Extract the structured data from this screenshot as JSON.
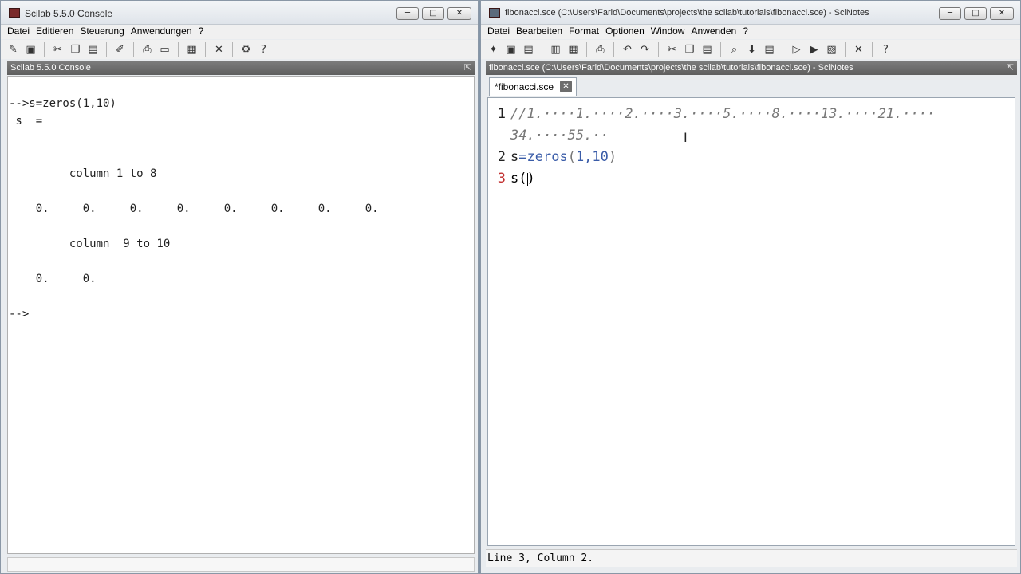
{
  "console": {
    "title": "Scilab 5.5.0 Console",
    "menu": [
      "Datei",
      "Editieren",
      "Steuerung",
      "Anwendungen",
      "?"
    ],
    "dock_title": "Scilab 5.5.0 Console",
    "lines": [
      "-->s=zeros(1,10)",
      " s  =",
      "",
      "",
      "         column 1 to 8",
      "",
      "    0.     0.     0.     0.     0.     0.     0.     0.",
      "",
      "         column  9 to 10",
      "",
      "    0.     0.",
      "",
      "-->"
    ]
  },
  "scinotes": {
    "title": "fibonacci.sce (C:\\Users\\Farid\\Documents\\projects\\the scilab\\tutorials\\fibonacci.sce) - SciNotes",
    "menu": [
      "Datei",
      "Bearbeiten",
      "Format",
      "Optionen",
      "Window",
      "Anwenden",
      "?"
    ],
    "dock_title": "fibonacci.sce (C:\\Users\\Farid\\Documents\\projects\\the scilab\\tutorials\\fibonacci.sce) - SciNotes",
    "tab_label": "*fibonacci.sce",
    "line_numbers": [
      "1",
      "2",
      "3"
    ],
    "code": {
      "line1a": "//1.····1.····2.····3.····5.····8.····13.····21.····",
      "line1b": "34.····55.··",
      "line2_var": "s",
      "line2_op": "=",
      "line2_fn": "zeros",
      "line2_open": "(",
      "line2_args": "1,10",
      "line2_close": ")",
      "line3": "s()"
    },
    "status": "Line 3, Column 2."
  },
  "window_buttons": {
    "minimize": "─",
    "maximize": "□",
    "close": "✕"
  }
}
